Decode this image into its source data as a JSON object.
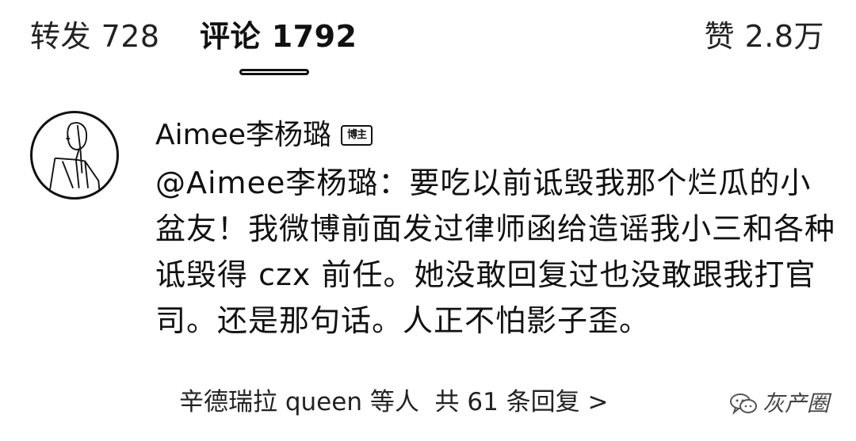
{
  "tabs": {
    "repost": "转发 728",
    "comments": "评论 1792",
    "likes": "赞 2.8万"
  },
  "comment": {
    "author": "Aimee李杨璐",
    "badge": "博主",
    "text": "@Aimee李杨璐：要吃以前诋毁我那个烂瓜的小盆友！我微博前面发过律师函给造谣我小三和各种诋毁得 czx 前任。她没敢回复过也没敢跟我打官司。还是那句话。人正不怕影子歪。",
    "replies_link": "辛德瑞拉 queen 等人  共 61 条回复 >"
  },
  "watermark": {
    "text": "灰产圈",
    "icon": "wechat-icon"
  },
  "colors": {
    "text": "#111111",
    "background": "#ffffff"
  }
}
